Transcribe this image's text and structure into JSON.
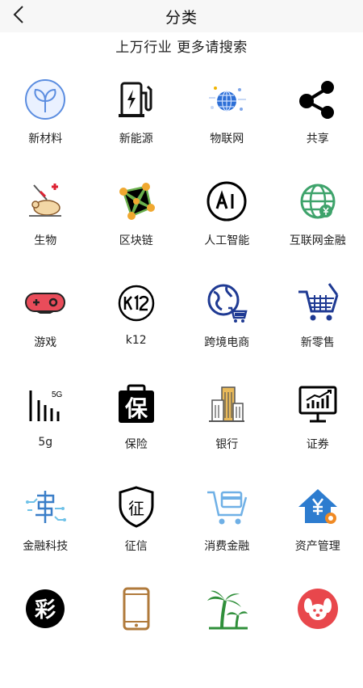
{
  "header": {
    "title": "分类"
  },
  "subtitle": "上万行业 更多请搜索",
  "categories": [
    {
      "label": "新材料",
      "icon": "sprout-circle-icon"
    },
    {
      "label": "新能源",
      "icon": "charging-station-icon"
    },
    {
      "label": "物联网",
      "icon": "globe-network-icon"
    },
    {
      "label": "共享",
      "icon": "share-icon"
    },
    {
      "label": "生物",
      "icon": "lab-mouse-icon"
    },
    {
      "label": "区块链",
      "icon": "blockchain-icon"
    },
    {
      "label": "人工智能",
      "icon": "ai-icon"
    },
    {
      "label": "互联网金融",
      "icon": "globe-yen-icon"
    },
    {
      "label": "游戏",
      "icon": "gamepad-icon"
    },
    {
      "label": "k12",
      "icon": "k12-icon"
    },
    {
      "label": "跨境电商",
      "icon": "globe-cart-icon"
    },
    {
      "label": "新零售",
      "icon": "shopping-cart-icon"
    },
    {
      "label": "5g",
      "icon": "signal-5g-icon"
    },
    {
      "label": "保险",
      "icon": "insurance-icon"
    },
    {
      "label": "银行",
      "icon": "bank-building-icon"
    },
    {
      "label": "证券",
      "icon": "stock-monitor-icon"
    },
    {
      "label": "金融科技",
      "icon": "fintech-icon"
    },
    {
      "label": "征信",
      "icon": "credit-shield-icon"
    },
    {
      "label": "消费金融",
      "icon": "cart-card-icon"
    },
    {
      "label": "资产管理",
      "icon": "house-yen-icon"
    },
    {
      "label": "",
      "icon": "lottery-icon"
    },
    {
      "label": "",
      "icon": "smartphone-icon"
    },
    {
      "label": "",
      "icon": "palm-tree-icon"
    },
    {
      "label": "",
      "icon": "pet-dog-icon"
    }
  ]
}
